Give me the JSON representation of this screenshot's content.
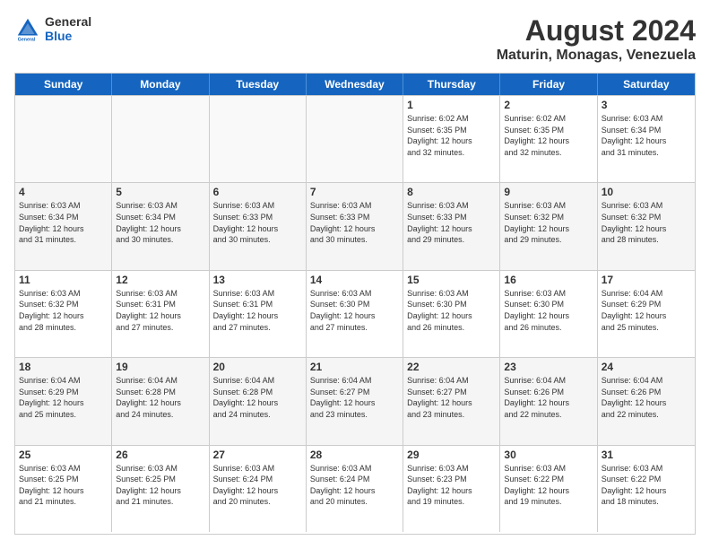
{
  "header": {
    "logo": {
      "general": "General",
      "blue": "Blue"
    },
    "month_year": "August 2024",
    "location": "Maturin, Monagas, Venezuela"
  },
  "weekdays": [
    "Sunday",
    "Monday",
    "Tuesday",
    "Wednesday",
    "Thursday",
    "Friday",
    "Saturday"
  ],
  "weeks": [
    [
      {
        "day": "",
        "info": "",
        "empty": true
      },
      {
        "day": "",
        "info": "",
        "empty": true
      },
      {
        "day": "",
        "info": "",
        "empty": true
      },
      {
        "day": "",
        "info": "",
        "empty": true
      },
      {
        "day": "1",
        "info": "Sunrise: 6:02 AM\nSunset: 6:35 PM\nDaylight: 12 hours\nand 32 minutes."
      },
      {
        "day": "2",
        "info": "Sunrise: 6:02 AM\nSunset: 6:35 PM\nDaylight: 12 hours\nand 32 minutes."
      },
      {
        "day": "3",
        "info": "Sunrise: 6:03 AM\nSunset: 6:34 PM\nDaylight: 12 hours\nand 31 minutes."
      }
    ],
    [
      {
        "day": "4",
        "info": "Sunrise: 6:03 AM\nSunset: 6:34 PM\nDaylight: 12 hours\nand 31 minutes."
      },
      {
        "day": "5",
        "info": "Sunrise: 6:03 AM\nSunset: 6:34 PM\nDaylight: 12 hours\nand 30 minutes."
      },
      {
        "day": "6",
        "info": "Sunrise: 6:03 AM\nSunset: 6:33 PM\nDaylight: 12 hours\nand 30 minutes."
      },
      {
        "day": "7",
        "info": "Sunrise: 6:03 AM\nSunset: 6:33 PM\nDaylight: 12 hours\nand 30 minutes."
      },
      {
        "day": "8",
        "info": "Sunrise: 6:03 AM\nSunset: 6:33 PM\nDaylight: 12 hours\nand 29 minutes."
      },
      {
        "day": "9",
        "info": "Sunrise: 6:03 AM\nSunset: 6:32 PM\nDaylight: 12 hours\nand 29 minutes."
      },
      {
        "day": "10",
        "info": "Sunrise: 6:03 AM\nSunset: 6:32 PM\nDaylight: 12 hours\nand 28 minutes."
      }
    ],
    [
      {
        "day": "11",
        "info": "Sunrise: 6:03 AM\nSunset: 6:32 PM\nDaylight: 12 hours\nand 28 minutes."
      },
      {
        "day": "12",
        "info": "Sunrise: 6:03 AM\nSunset: 6:31 PM\nDaylight: 12 hours\nand 27 minutes."
      },
      {
        "day": "13",
        "info": "Sunrise: 6:03 AM\nSunset: 6:31 PM\nDaylight: 12 hours\nand 27 minutes."
      },
      {
        "day": "14",
        "info": "Sunrise: 6:03 AM\nSunset: 6:30 PM\nDaylight: 12 hours\nand 27 minutes."
      },
      {
        "day": "15",
        "info": "Sunrise: 6:03 AM\nSunset: 6:30 PM\nDaylight: 12 hours\nand 26 minutes."
      },
      {
        "day": "16",
        "info": "Sunrise: 6:03 AM\nSunset: 6:30 PM\nDaylight: 12 hours\nand 26 minutes."
      },
      {
        "day": "17",
        "info": "Sunrise: 6:04 AM\nSunset: 6:29 PM\nDaylight: 12 hours\nand 25 minutes."
      }
    ],
    [
      {
        "day": "18",
        "info": "Sunrise: 6:04 AM\nSunset: 6:29 PM\nDaylight: 12 hours\nand 25 minutes."
      },
      {
        "day": "19",
        "info": "Sunrise: 6:04 AM\nSunset: 6:28 PM\nDaylight: 12 hours\nand 24 minutes."
      },
      {
        "day": "20",
        "info": "Sunrise: 6:04 AM\nSunset: 6:28 PM\nDaylight: 12 hours\nand 24 minutes."
      },
      {
        "day": "21",
        "info": "Sunrise: 6:04 AM\nSunset: 6:27 PM\nDaylight: 12 hours\nand 23 minutes."
      },
      {
        "day": "22",
        "info": "Sunrise: 6:04 AM\nSunset: 6:27 PM\nDaylight: 12 hours\nand 23 minutes."
      },
      {
        "day": "23",
        "info": "Sunrise: 6:04 AM\nSunset: 6:26 PM\nDaylight: 12 hours\nand 22 minutes."
      },
      {
        "day": "24",
        "info": "Sunrise: 6:04 AM\nSunset: 6:26 PM\nDaylight: 12 hours\nand 22 minutes."
      }
    ],
    [
      {
        "day": "25",
        "info": "Sunrise: 6:03 AM\nSunset: 6:25 PM\nDaylight: 12 hours\nand 21 minutes."
      },
      {
        "day": "26",
        "info": "Sunrise: 6:03 AM\nSunset: 6:25 PM\nDaylight: 12 hours\nand 21 minutes."
      },
      {
        "day": "27",
        "info": "Sunrise: 6:03 AM\nSunset: 6:24 PM\nDaylight: 12 hours\nand 20 minutes."
      },
      {
        "day": "28",
        "info": "Sunrise: 6:03 AM\nSunset: 6:24 PM\nDaylight: 12 hours\nand 20 minutes."
      },
      {
        "day": "29",
        "info": "Sunrise: 6:03 AM\nSunset: 6:23 PM\nDaylight: 12 hours\nand 19 minutes."
      },
      {
        "day": "30",
        "info": "Sunrise: 6:03 AM\nSunset: 6:22 PM\nDaylight: 12 hours\nand 19 minutes."
      },
      {
        "day": "31",
        "info": "Sunrise: 6:03 AM\nSunset: 6:22 PM\nDaylight: 12 hours\nand 18 minutes."
      }
    ]
  ]
}
